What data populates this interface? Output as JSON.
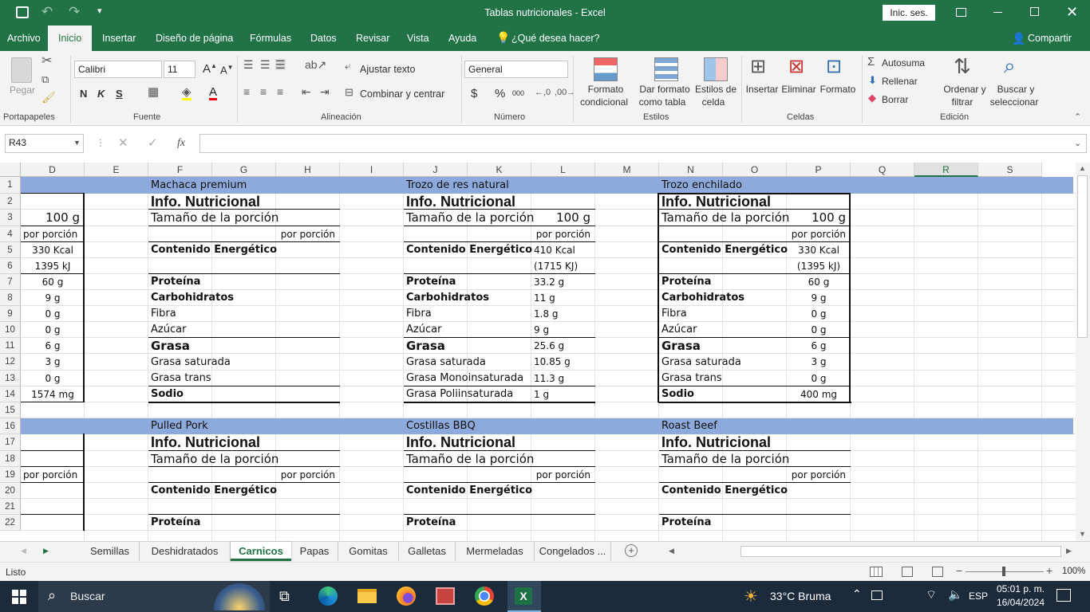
{
  "title_bar": {
    "title": "Tablas nutricionales  -  Excel",
    "signin": "Inic. ses."
  },
  "ribbon_tabs": [
    "Archivo",
    "Inicio",
    "Insertar",
    "Diseño de página",
    "Fórmulas",
    "Datos",
    "Revisar",
    "Vista",
    "Ayuda"
  ],
  "tell_me": "¿Qué desea hacer?",
  "share": "Compartir",
  "ribbon": {
    "paste": "Pegar",
    "font_name": "Calibri",
    "font_size": "11",
    "bold": "N",
    "italic": "K",
    "underline": "S",
    "wrap_text": "Ajustar texto",
    "merge": "Combinar y centrar",
    "number_format": "General",
    "currency": "$",
    "percent": "%",
    "thousands": "000",
    "cond_format": "Formato condicional",
    "cond_format_l1": "Formato",
    "cond_format_l2": "condicional",
    "format_table_l1": "Dar formato",
    "format_table_l2": "como tabla",
    "cell_styles_l1": "Estilos de",
    "cell_styles_l2": "celda",
    "insert": "Insertar",
    "delete": "Eliminar",
    "format": "Formato",
    "autosum": "Autosuma",
    "fill": "Rellenar",
    "clear": "Borrar",
    "sort_l1": "Ordenar y",
    "sort_l2": "filtrar",
    "find_l1": "Buscar y",
    "find_l2": "seleccionar",
    "groups": [
      "Portapapeles",
      "Fuente",
      "Alineación",
      "Número",
      "Estilos",
      "Celdas",
      "Edición"
    ]
  },
  "name_box": "R43",
  "fx": "fx",
  "columns": [
    "D",
    "E",
    "F",
    "G",
    "H",
    "I",
    "J",
    "K",
    "L",
    "M",
    "N",
    "O",
    "P",
    "Q",
    "R",
    "S"
  ],
  "rows": [
    "1",
    "2",
    "3",
    "4",
    "5",
    "6",
    "7",
    "8",
    "9",
    "10",
    "11",
    "12",
    "13",
    "14",
    "15",
    "16",
    "17",
    "18",
    "19",
    "20",
    "21",
    "22"
  ],
  "cells": {
    "t1": "Machaca premium",
    "t2": "Trozo de res natural",
    "t3": "Trozo enchilado",
    "t4": "Pulled Pork",
    "t5": "Costillas BBQ",
    "t6": "Roast Beef",
    "info": "Info. Nutricional",
    "portion_size": "Tamaño de la porción",
    "per_portion": "por porción",
    "energy": "Contenido Energético",
    "protein": "Proteína",
    "carbs": "Carbohidratos",
    "fiber": "Fibra",
    "sugar": "Azúcar",
    "fat": "Grasa",
    "sat_fat": "Grasa saturada",
    "trans_fat": "Grasa trans",
    "mono_fat": "Grasa Monoinsaturada",
    "poly_fat": "Grasa Poliinsaturada",
    "sodium": "Sodio",
    "d3": "100 g",
    "d5": "330 Kcal",
    "d6": "1395 kJ",
    "d7": "60 g",
    "d8": "9 g",
    "d9": "0 g",
    "d10": "0 g",
    "d11": "6 g",
    "d12": "3 g",
    "d13": "0 g",
    "d14": "1574 mg",
    "l3": "100 g",
    "l5": "410 Kcal",
    "l6": "(1715 KJ)",
    "l7": "33.2 g",
    "l8": "11 g",
    "l9": "1.8 g",
    "l10": "9 g",
    "l11": "25.6 g",
    "l12": "10.85 g",
    "l13": "11.3 g",
    "l14": "1 g",
    "p3": "100 g",
    "p5": "330 Kcal",
    "p6": "(1395 kJ)",
    "p7": "60 g",
    "p8": "9 g",
    "p9": "0 g",
    "p10": "0 g",
    "p11": "6 g",
    "p12": "3 g",
    "p13": "0 g",
    "p14": "400 mg"
  },
  "sheets": [
    "Semillas",
    "Deshidratados",
    "Carnicos",
    "Papas",
    "Gomitas",
    "Galletas",
    "Mermeladas",
    "Congelados ..."
  ],
  "active_sheet": "Carnicos",
  "status": {
    "ready": "Listo",
    "zoom": "100%"
  },
  "taskbar": {
    "search": "Buscar",
    "weather": "33°C  Bruma",
    "lang": "ESP",
    "time": "05:01 p. m.",
    "date": "16/04/2024"
  },
  "colors": {
    "excel_green": "#217346",
    "title_row": "#8ea9db",
    "grid": "#d4d4d4"
  }
}
